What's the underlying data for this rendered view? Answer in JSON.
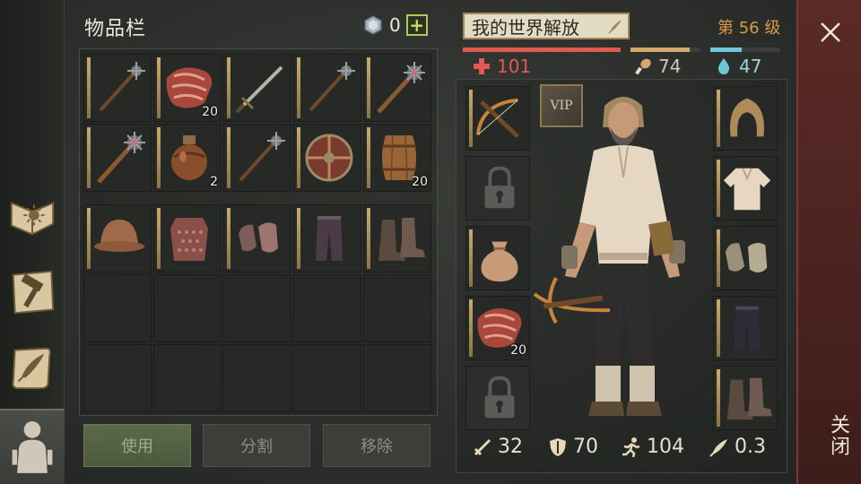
{
  "inventory": {
    "title": "物品栏",
    "gem_count": "0",
    "gem_plus": "+",
    "rows": [
      [
        {
          "item": "spiked-mace-icon",
          "qty": ""
        },
        {
          "item": "raw-meat-icon",
          "qty": "20"
        },
        {
          "item": "sword-icon",
          "qty": ""
        },
        {
          "item": "spiked-mace-icon",
          "qty": ""
        },
        {
          "item": "morning-star-icon",
          "qty": ""
        }
      ],
      [
        {
          "item": "morning-star-icon",
          "qty": ""
        },
        {
          "item": "flask-icon",
          "qty": "2"
        },
        {
          "item": "spiked-mace-icon",
          "qty": ""
        },
        {
          "item": "round-shield-icon",
          "qty": ""
        },
        {
          "item": "barrel-icon",
          "qty": "20"
        }
      ],
      [
        {
          "item": "kettle-helmet-icon",
          "qty": ""
        },
        {
          "item": "chainmail-icon",
          "qty": ""
        },
        {
          "item": "mail-gloves-icon",
          "qty": ""
        },
        {
          "item": "leather-pants-icon",
          "qty": ""
        },
        {
          "item": "boots-icon",
          "qty": ""
        }
      ]
    ],
    "buttons": {
      "use": "使用",
      "split": "分割",
      "remove": "移除"
    }
  },
  "character": {
    "name": "我的世界解放",
    "level": "第 56 级",
    "health": "101",
    "food": "74",
    "water": "47",
    "health_fill": 1.0,
    "food_fill": 0.85,
    "water_fill": 0.45,
    "vip": "VIP",
    "left_slots": [
      {
        "item": "crossbow-icon",
        "qty": "",
        "locked": false
      },
      {
        "item": "lock-icon",
        "qty": "",
        "locked": true
      },
      {
        "item": "bag-icon",
        "qty": "",
        "locked": false
      },
      {
        "item": "raw-meat-icon",
        "qty": "20",
        "locked": false
      },
      {
        "item": "lock-icon",
        "qty": "",
        "locked": true
      }
    ],
    "right_slots": [
      {
        "item": "hood-icon"
      },
      {
        "item": "shirt-icon"
      },
      {
        "item": "gloves-icon"
      },
      {
        "item": "pants-icon"
      },
      {
        "item": "boots-icon"
      }
    ],
    "stats": {
      "attack": "32",
      "defense": "70",
      "speed": "104",
      "weight": "0.3"
    }
  },
  "close": {
    "label": "关闭"
  },
  "colors": {
    "health": "#e05a4f",
    "food": "#d4a86a",
    "water": "#6fc7d6",
    "level": "#d99a46",
    "close_panel": "#4a2220"
  }
}
